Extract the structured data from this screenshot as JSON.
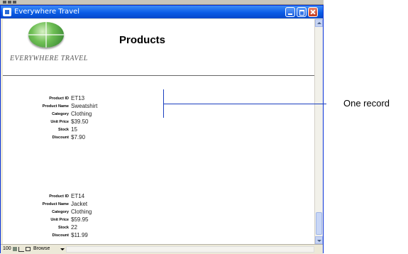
{
  "window": {
    "title": "Everywhere Travel"
  },
  "logo": {
    "text": "EVERYWHERE TRAVEL"
  },
  "page": {
    "title": "Products"
  },
  "records": [
    {
      "fields": [
        {
          "label": "Product ID",
          "value": "ET13"
        },
        {
          "label": "Product Name",
          "value": "Sweatshirt"
        },
        {
          "label": "Category",
          "value": "Clothing"
        },
        {
          "label": "Unit Price",
          "value": "$39.50"
        },
        {
          "label": "Stock",
          "value": "15"
        },
        {
          "label": "Discount",
          "value": "$7.90"
        }
      ]
    },
    {
      "fields": [
        {
          "label": "Product ID",
          "value": "ET14"
        },
        {
          "label": "Product Name",
          "value": "Jacket"
        },
        {
          "label": "Category",
          "value": "Clothing"
        },
        {
          "label": "Unit Price",
          "value": "$59.95"
        },
        {
          "label": "Stock",
          "value": "22"
        },
        {
          "label": "Discount",
          "value": "$11.99"
        }
      ]
    }
  ],
  "statusbar": {
    "zoom": "100",
    "mode": "Browse"
  },
  "annotation": {
    "text": "One record"
  },
  "colors": {
    "titlebar": "#0a5ce6",
    "annotation_line": "#1a3fbf"
  }
}
